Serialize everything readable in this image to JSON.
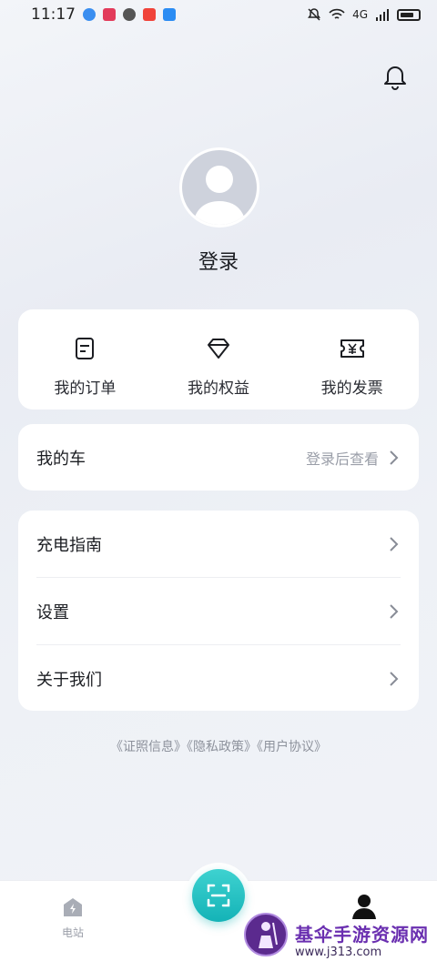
{
  "status_bar": {
    "time": "11:17",
    "network": "4G",
    "icons": [
      "globe-icon",
      "heart-app-icon",
      "wechat-icon",
      "red-app-icon",
      "blue-app-icon",
      "mute-bell-icon",
      "wifi-icon",
      "signal-icon",
      "battery-icon"
    ]
  },
  "header": {
    "bell_icon": "bell-icon"
  },
  "profile": {
    "avatar_icon": "default-avatar-icon",
    "login_label": "登录"
  },
  "quick_actions": [
    {
      "label": "我的订单",
      "icon": "order-icon"
    },
    {
      "label": "我的权益",
      "icon": "diamond-icon"
    },
    {
      "label": "我的发票",
      "icon": "invoice-icon"
    }
  ],
  "car": {
    "label": "我的车",
    "hint": "登录后查看"
  },
  "menu": [
    {
      "label": "充电指南"
    },
    {
      "label": "设置"
    },
    {
      "label": "关于我们"
    }
  ],
  "legal": "《证照信息》《隐私政策》《用户协议》",
  "tabbar": {
    "station_label": "电站",
    "scan_icon": "scan-icon",
    "me_icon": "person-icon"
  },
  "watermark": {
    "title": "基伞手游资源网",
    "url": "www.j313.com"
  },
  "colors": {
    "accent": "#1fc0c2",
    "background": "#eef1f6"
  }
}
